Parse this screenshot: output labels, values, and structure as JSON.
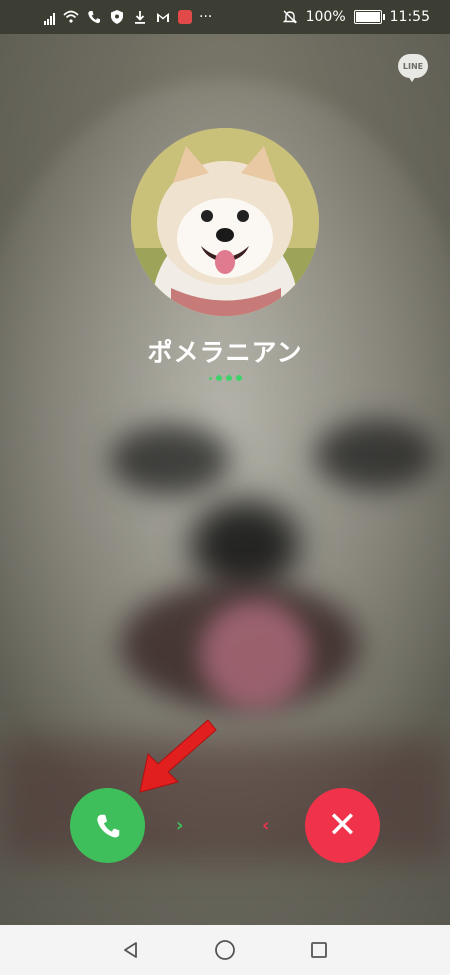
{
  "status_bar": {
    "battery": "100%",
    "time": "11:55",
    "more": "···",
    "icons": [
      "signal-icon",
      "wifi-icon",
      "phone-icon",
      "shield-icon",
      "download-icon",
      "mail-icon",
      "huawei-app-icon",
      "more-icon",
      "mute-bell-icon",
      "battery-icon"
    ]
  },
  "brand_badge": "LINE",
  "call": {
    "caller_name": "ポメラニアン",
    "avatar_icon": "pomeranian-avatar",
    "accept_icon": "phone-icon",
    "decline_icon": "close-icon",
    "accept_hint": "›",
    "decline_hint": "‹",
    "decline_symbol": "✕",
    "accent_green": "#3fbf5b",
    "accent_red": "#f0334b"
  },
  "annotation": {
    "arrow_color": "#e21f1f"
  },
  "nav": {
    "back_icon": "back-triangle-icon",
    "home_icon": "home-circle-icon",
    "recents_icon": "recents-square-icon"
  }
}
